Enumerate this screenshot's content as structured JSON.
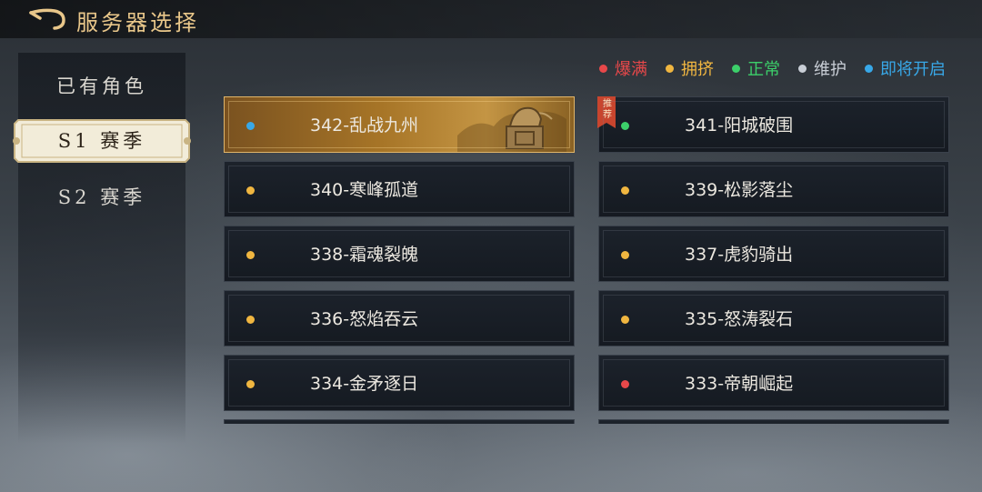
{
  "header": {
    "title": "服务器选择"
  },
  "sidebar": {
    "items": [
      {
        "label": "已有角色"
      },
      {
        "label": "S1 赛季"
      },
      {
        "label": "S2 赛季"
      }
    ]
  },
  "legend": [
    {
      "label": "爆满",
      "color": "#e8484a"
    },
    {
      "label": "拥挤",
      "color": "#f0b640"
    },
    {
      "label": "正常",
      "color": "#3ccf6a"
    },
    {
      "label": "维护",
      "color": "#c9ced6"
    },
    {
      "label": "即将开启",
      "color": "#38a8e8"
    }
  ],
  "servers": [
    {
      "name": "342-乱战九州",
      "status_color": "#38a8e8",
      "selected": true
    },
    {
      "name": "341-阳城破围",
      "status_color": "#3ccf6a",
      "badge": "推荐"
    },
    {
      "name": "340-寒峰孤道",
      "status_color": "#f0b640"
    },
    {
      "name": "339-松影落尘",
      "status_color": "#f0b640"
    },
    {
      "name": "338-霜魂裂魄",
      "status_color": "#f0b640"
    },
    {
      "name": "337-虎豹骑出",
      "status_color": "#f0b640"
    },
    {
      "name": "336-怒焰吞云",
      "status_color": "#f0b640"
    },
    {
      "name": "335-怒涛裂石",
      "status_color": "#f0b640"
    },
    {
      "name": "334-金矛逐日",
      "status_color": "#f0b640"
    },
    {
      "name": "333-帝朝崛起",
      "status_color": "#e8484a"
    }
  ]
}
